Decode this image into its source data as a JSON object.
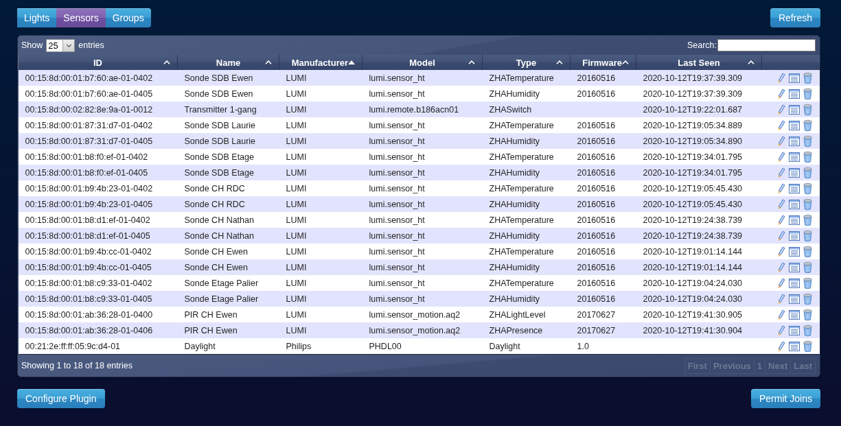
{
  "tabs": [
    {
      "label": "Lights",
      "selected": false
    },
    {
      "label": "Sensors",
      "selected": true
    },
    {
      "label": "Groups",
      "selected": false
    }
  ],
  "refresh_button": "Refresh",
  "table": {
    "length_menu": {
      "label_before": "Show",
      "value": "25",
      "label_after": "entries"
    },
    "search": {
      "label": "Search:"
    },
    "columns": [
      {
        "label": "ID",
        "sorted": false
      },
      {
        "label": "Name",
        "sorted": false
      },
      {
        "label": "Manufacturer",
        "sorted": true
      },
      {
        "label": "Model",
        "sorted": false
      },
      {
        "label": "Type",
        "sorted": false
      },
      {
        "label": "Firmware",
        "sorted": false
      },
      {
        "label": "Last Seen",
        "sorted": false
      }
    ],
    "rows": [
      {
        "id": "00:15:8d:00:01:b7:60:ae-01-0402",
        "name": "Sonde SDB Ewen",
        "manufacturer": "LUMI",
        "model": "lumi.sensor_ht",
        "type": "ZHATemperature",
        "firmware": "20160516",
        "last_seen": "2020-10-12T19:37:39.309"
      },
      {
        "id": "00:15:8d:00:01:b7:60:ae-01-0405",
        "name": "Sonde SDB Ewen",
        "manufacturer": "LUMI",
        "model": "lumi.sensor_ht",
        "type": "ZHAHumidity",
        "firmware": "20160516",
        "last_seen": "2020-10-12T19:37:39.309"
      },
      {
        "id": "00:15:8d:00:02:82:8e:9a-01-0012",
        "name": "Transmitter 1-gang",
        "manufacturer": "LUMI",
        "model": "lumi.remote.b186acn01",
        "type": "ZHASwitch",
        "last_seen": "2020-10-12T19:22:01.687"
      },
      {
        "id": "00:15:8d:00:01:87:31:d7-01-0402",
        "name": "Sonde SDB Laurie",
        "manufacturer": "LUMI",
        "model": "lumi.sensor_ht",
        "type": "ZHATemperature",
        "firmware": "20160516",
        "last_seen": "2020-10-12T19:05:34.889"
      },
      {
        "id": "00:15:8d:00:01:87:31:d7-01-0405",
        "name": "Sonde SDB Laurie",
        "manufacturer": "LUMI",
        "model": "lumi.sensor_ht",
        "type": "ZHAHumidity",
        "firmware": "20160516",
        "last_seen": "2020-10-12T19:05:34.890"
      },
      {
        "id": "00:15:8d:00:01:b8:f0:ef-01-0402",
        "name": "Sonde SDB Etage",
        "manufacturer": "LUMI",
        "model": "lumi.sensor_ht",
        "type": "ZHATemperature",
        "firmware": "20160516",
        "last_seen": "2020-10-12T19:34:01.795"
      },
      {
        "id": "00:15:8d:00:01:b8:f0:ef-01-0405",
        "name": "Sonde SDB Etage",
        "manufacturer": "LUMI",
        "model": "lumi.sensor_ht",
        "type": "ZHAHumidity",
        "firmware": "20160516",
        "last_seen": "2020-10-12T19:34:01.795"
      },
      {
        "id": "00:15:8d:00:01:b9:4b:23-01-0402",
        "name": "Sonde CH RDC",
        "manufacturer": "LUMI",
        "model": "lumi.sensor_ht",
        "type": "ZHATemperature",
        "firmware": "20160516",
        "last_seen": "2020-10-12T19:05:45.430"
      },
      {
        "id": "00:15:8d:00:01:b9:4b:23-01-0405",
        "name": "Sonde CH RDC",
        "manufacturer": "LUMI",
        "model": "lumi.sensor_ht",
        "type": "ZHAHumidity",
        "firmware": "20160516",
        "last_seen": "2020-10-12T19:05:45.430"
      },
      {
        "id": "00:15:8d:00:01:b8:d1:ef-01-0402",
        "name": "Sonde CH Nathan",
        "manufacturer": "LUMI",
        "model": "lumi.sensor_ht",
        "type": "ZHATemperature",
        "firmware": "20160516",
        "last_seen": "2020-10-12T19:24:38.739"
      },
      {
        "id": "00:15:8d:00:01:b8:d1:ef-01-0405",
        "name": "Sonde CH Nathan",
        "manufacturer": "LUMI",
        "model": "lumi.sensor_ht",
        "type": "ZHAHumidity",
        "firmware": "20160516",
        "last_seen": "2020-10-12T19:24:38.739"
      },
      {
        "id": "00:15:8d:00:01:b9:4b:cc-01-0402",
        "name": "Sonde CH Ewen",
        "manufacturer": "LUMI",
        "model": "lumi.sensor_ht",
        "type": "ZHATemperature",
        "firmware": "20160516",
        "last_seen": "2020-10-12T19:01:14.144"
      },
      {
        "id": "00:15:8d:00:01:b9:4b:cc-01-0405",
        "name": "Sonde CH Ewen",
        "manufacturer": "LUMI",
        "model": "lumi.sensor_ht",
        "type": "ZHAHumidity",
        "firmware": "20160516",
        "last_seen": "2020-10-12T19:01:14.144"
      },
      {
        "id": "00:15:8d:00:01:b8:c9:33-01-0402",
        "name": "Sonde Etage Palier",
        "manufacturer": "LUMI",
        "model": "lumi.sensor_ht",
        "type": "ZHATemperature",
        "firmware": "20160516",
        "last_seen": "2020-10-12T19:04:24.030"
      },
      {
        "id": "00:15:8d:00:01:b8:c9:33-01-0405",
        "name": "Sonde Etage Palier",
        "manufacturer": "LUMI",
        "model": "lumi.sensor_ht",
        "type": "ZHAHumidity",
        "firmware": "20160516",
        "last_seen": "2020-10-12T19:04:24.030"
      },
      {
        "id": "00:15:8d:00:01:ab:36:28-01-0400",
        "name": "PIR CH Ewen",
        "manufacturer": "LUMI",
        "model": "lumi.sensor_motion.aq2",
        "type": "ZHALightLevel",
        "firmware": "20170627",
        "last_seen": "2020-10-12T19:41:30.905"
      },
      {
        "id": "00:15:8d:00:01:ab:36:28-01-0406",
        "name": "PIR CH Ewen",
        "manufacturer": "LUMI",
        "model": "lumi.sensor_motion.aq2",
        "type": "ZHAPresence",
        "firmware": "20170627",
        "last_seen": "2020-10-12T19:41:30.904"
      },
      {
        "id": "00:21:2e:ff:ff:05:9c:d4-01",
        "name": "Daylight",
        "manufacturer": "Philips",
        "model": "PHDL00",
        "type": "Daylight",
        "firmware": "1.0"
      }
    ],
    "info": "Showing 1 to 18 of 18 entries",
    "pagination": [
      {
        "label": "First",
        "disabled": true
      },
      {
        "label": "Previous",
        "disabled": true
      },
      {
        "label": "1",
        "disabled": true
      },
      {
        "label": "Next",
        "disabled": true
      },
      {
        "label": "Last",
        "disabled": true
      }
    ]
  },
  "footer_buttons": [
    "Configure Plugin",
    "Permit Joins"
  ]
}
